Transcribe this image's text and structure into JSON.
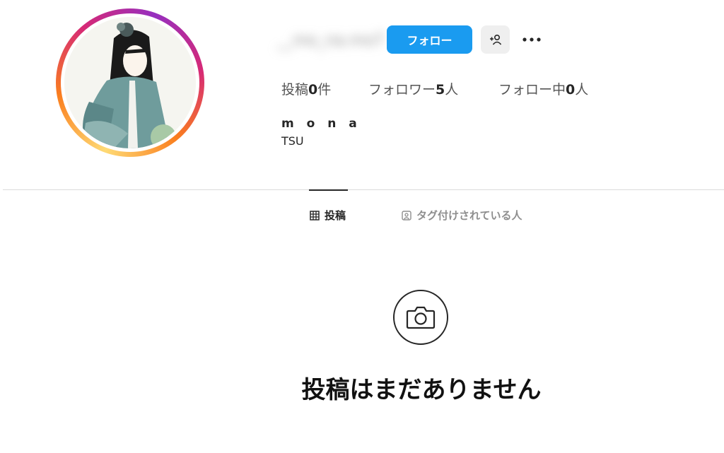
{
  "profile": {
    "username": "__mo_na.mo7",
    "follow_label": "フォロー",
    "full_name": "m o n a",
    "bio": "TSU"
  },
  "stats": {
    "posts_label": "投稿",
    "posts_count": "0",
    "posts_unit": "件",
    "followers_label": "フォロワー",
    "followers_count": "5",
    "followers_unit": "人",
    "following_label": "フォロー中",
    "following_count": "0",
    "following_unit": "人"
  },
  "tabs": [
    {
      "label": "投稿",
      "icon": "grid-icon",
      "active": true
    },
    {
      "label": "タグ付けされている人",
      "icon": "tagged-user-icon",
      "active": false
    }
  ],
  "empty_state": {
    "icon": "camera-icon",
    "title": "投稿はまだありません"
  },
  "colors": {
    "accent": "#1a9bf0",
    "ring_gradient": [
      "#feda75",
      "#fa7e1e",
      "#d62976",
      "#962fbf"
    ]
  }
}
